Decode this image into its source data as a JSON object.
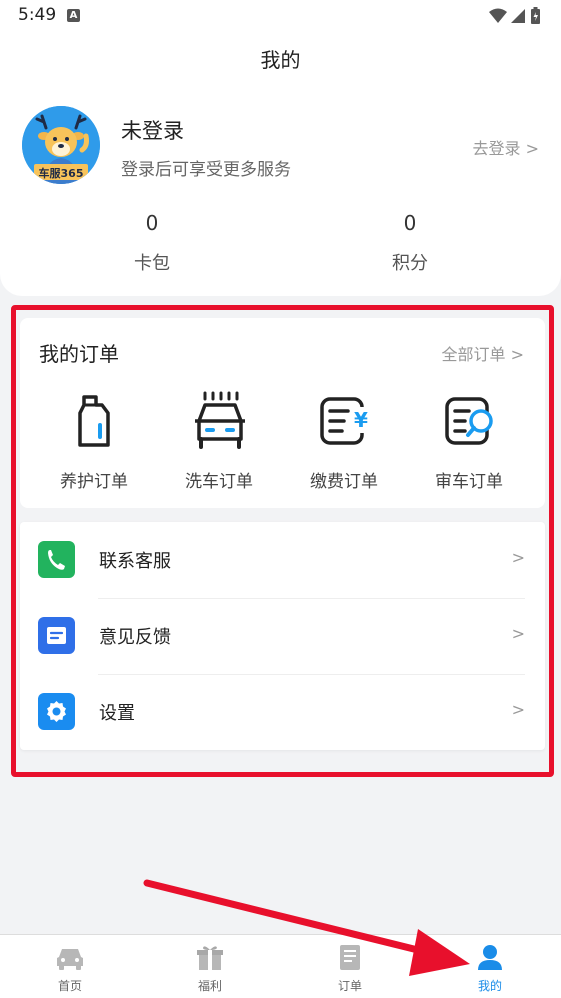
{
  "status_bar": {
    "time": "5:49",
    "notification_icon": "A"
  },
  "header": {
    "title": "我的"
  },
  "profile": {
    "avatar_badge": "车服365",
    "name": "未登录",
    "subtitle": "登录后可享受更多服务",
    "login_link": "去登录 >",
    "stats": [
      {
        "value": "0",
        "label": "卡包"
      },
      {
        "value": "0",
        "label": "积分"
      }
    ]
  },
  "orders": {
    "title": "我的订单",
    "all_link": "全部订单 >",
    "items": [
      {
        "label": "养护订单",
        "icon": "oil-bottle-icon"
      },
      {
        "label": "洗车订单",
        "icon": "car-wash-icon"
      },
      {
        "label": "缴费订单",
        "icon": "payment-doc-icon"
      },
      {
        "label": "审车订单",
        "icon": "inspection-doc-icon"
      }
    ]
  },
  "menu": {
    "items": [
      {
        "label": "联系客服",
        "arrow": ">",
        "icon": "phone-icon",
        "color": "#22b35e"
      },
      {
        "label": "意见反馈",
        "arrow": ">",
        "icon": "feedback-icon",
        "color": "#2f6fe8"
      },
      {
        "label": "设置",
        "arrow": ">",
        "icon": "gear-icon",
        "color": "#1a8cf0"
      }
    ]
  },
  "tabbar": {
    "tabs": [
      {
        "label": "首页",
        "icon": "car-icon"
      },
      {
        "label": "福利",
        "icon": "gift-icon"
      },
      {
        "label": "订单",
        "icon": "order-icon"
      },
      {
        "label": "我的",
        "icon": "user-icon",
        "active": true
      }
    ]
  },
  "colors": {
    "accent": "#1a8ce8",
    "highlight": "#e8102c"
  }
}
